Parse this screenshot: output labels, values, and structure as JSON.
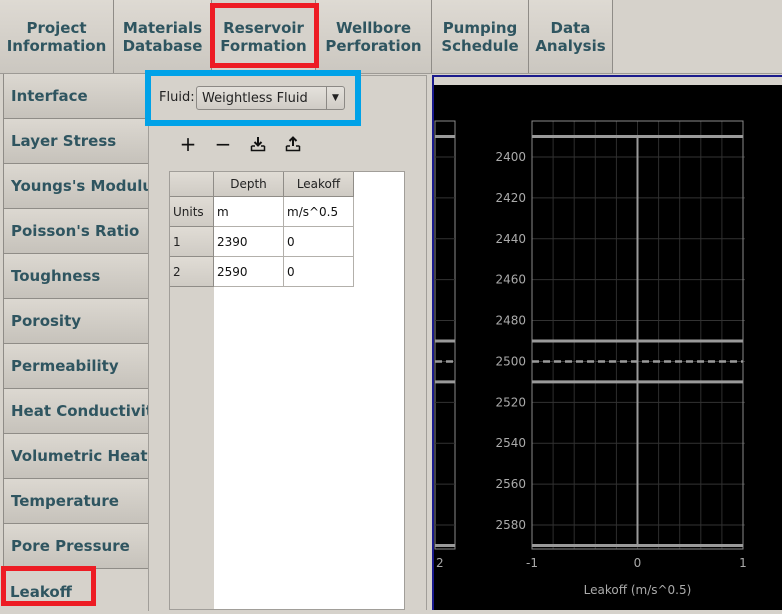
{
  "top_tabs": [
    {
      "label": "Project\nInformation",
      "active": false
    },
    {
      "label": "Materials\nDatabase",
      "active": false
    },
    {
      "label": "Reservoir\nFormation",
      "active": true
    },
    {
      "label": "Wellbore\nPerforation",
      "active": false
    },
    {
      "label": "Pumping\nSchedule",
      "active": false
    },
    {
      "label": "Data\nAnalysis",
      "active": false
    }
  ],
  "left_tabs": [
    {
      "label": "Interface"
    },
    {
      "label": "Layer Stress"
    },
    {
      "label": "Youngs's Modulus"
    },
    {
      "label": "Poisson's Ratio"
    },
    {
      "label": "Toughness"
    },
    {
      "label": "Porosity"
    },
    {
      "label": "Permeability"
    },
    {
      "label": "Heat Conductivity"
    },
    {
      "label": "Volumetric Heat Capacity"
    },
    {
      "label": "Temperature"
    },
    {
      "label": "Pore Pressure"
    },
    {
      "label": "Leakoff",
      "active": true
    }
  ],
  "fluid": {
    "label": "Fluid:",
    "selected": "Weightless Fluid"
  },
  "toolbar": {
    "add": {
      "icon": "plus-icon",
      "glyph": "+"
    },
    "remove": {
      "icon": "minus-icon",
      "glyph": "−"
    },
    "import": {
      "icon": "import-icon"
    },
    "export": {
      "icon": "export-icon"
    }
  },
  "table": {
    "columns": [
      "Depth",
      "Leakoff"
    ],
    "units_label": "Units",
    "units": [
      "m",
      "m/s^0.5"
    ],
    "rows": [
      {
        "index": "1",
        "depth": "2390",
        "leakoff": "0"
      },
      {
        "index": "2",
        "depth": "2590",
        "leakoff": "0"
      }
    ]
  },
  "highlights": {
    "red": "#ed1c24",
    "blue": "#00a2e8"
  },
  "chart_data": {
    "type": "line",
    "xlabel": "Leakoff (m/s^0.5)",
    "ylabel": "",
    "xlim": [
      -1,
      1
    ],
    "ylim": [
      2580,
      2400
    ],
    "y_ticks": [
      2400,
      2420,
      2440,
      2460,
      2480,
      2500,
      2520,
      2540,
      2560,
      2580
    ],
    "x_ticks": [
      -1,
      0,
      1
    ],
    "grid": true,
    "series": [
      {
        "name": "Leakoff",
        "x": [
          0,
          0
        ],
        "y": [
          2390,
          2590
        ]
      }
    ],
    "layer_boundaries": [
      2390,
      2490,
      2510,
      2590
    ],
    "dashed_reference": 2500,
    "left_partial_axis_tick": "2"
  }
}
